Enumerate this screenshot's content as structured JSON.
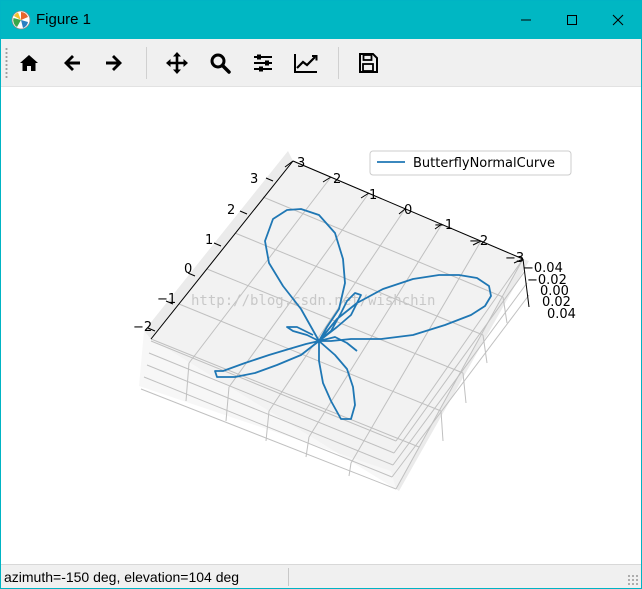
{
  "window": {
    "title": "Figure 1",
    "title_bar_color": "#00b7c3",
    "controls": {
      "minimize": "minimize-icon",
      "maximize": "maximize-icon",
      "close": "close-icon"
    }
  },
  "toolbar": {
    "buttons": [
      {
        "icon": "home-icon"
      },
      {
        "icon": "back-arrow-icon"
      },
      {
        "icon": "forward-arrow-icon"
      },
      {
        "icon": "pan-move-icon"
      },
      {
        "icon": "zoom-magnifier-icon"
      },
      {
        "icon": "configure-subplots-icon"
      },
      {
        "icon": "edit-axis-curve-icon"
      },
      {
        "icon": "save-floppy-icon"
      }
    ]
  },
  "chart_data": {
    "type": "line",
    "projection": "3d",
    "title": "",
    "legend": {
      "entries": [
        "ButterflyNormalCurve"
      ],
      "placement": "top-right"
    },
    "series": [
      {
        "name": "ButterflyNormalCurve",
        "color": "#1f77b4",
        "z": 0
      }
    ],
    "x_ticks": [
      "3",
      "2",
      "1",
      "0",
      "−1",
      "−2",
      "−3"
    ],
    "y_ticks": [
      "3",
      "2",
      "1",
      "0",
      "−1",
      "−2"
    ],
    "z_ticks": [
      "−0.04",
      "−0.02",
      "0.00",
      "0.02",
      "0.04"
    ],
    "xlim": [
      -3,
      3
    ],
    "ylim": [
      -2,
      3
    ],
    "zlim": [
      -0.04,
      0.04
    ],
    "grid": true,
    "view": {
      "azimuth": -150,
      "elevation": 104
    }
  },
  "watermark": "http://blog.csdn.net/wishchin",
  "status": {
    "text": "azimuth=-150 deg, elevation=104 deg"
  }
}
